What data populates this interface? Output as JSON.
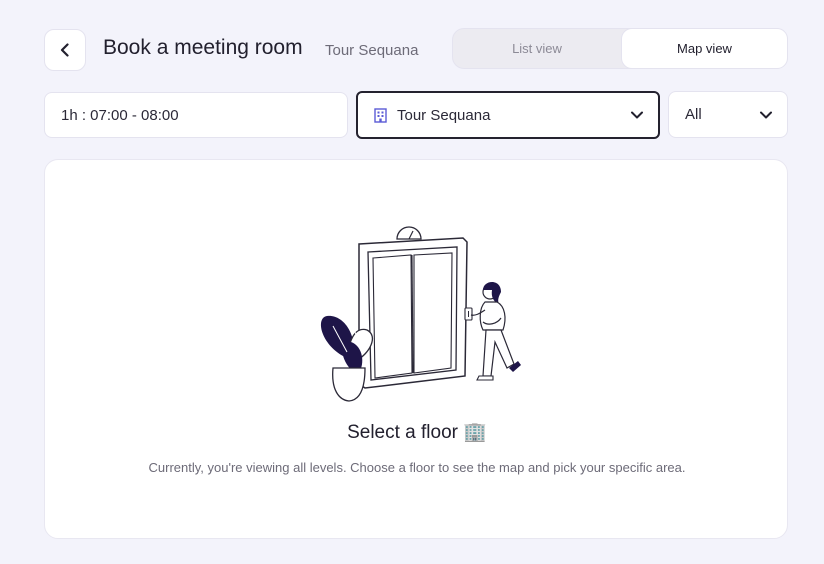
{
  "header": {
    "title": "Book a meeting room",
    "subtitle": "Tour Sequana"
  },
  "view_toggle": {
    "options": [
      {
        "label": "List view",
        "selected": false
      },
      {
        "label": "Map view",
        "selected": true
      }
    ]
  },
  "filters": {
    "time_value": "1h : 07:00 - 08:00",
    "building_value": "Tour Sequana",
    "level_value": "All"
  },
  "empty_state": {
    "title": "Select a floor 🏢",
    "description": "Currently, you're viewing all levels. Choose a floor to see the map and pick your specific area."
  },
  "colors": {
    "background": "#f3f3fb",
    "accent_dark": "#1e1548",
    "building_icon": "#5b5bd6"
  },
  "icons": {
    "back": "chevron-left-icon",
    "building": "building-icon",
    "dropdown": "chevron-down-icon"
  }
}
